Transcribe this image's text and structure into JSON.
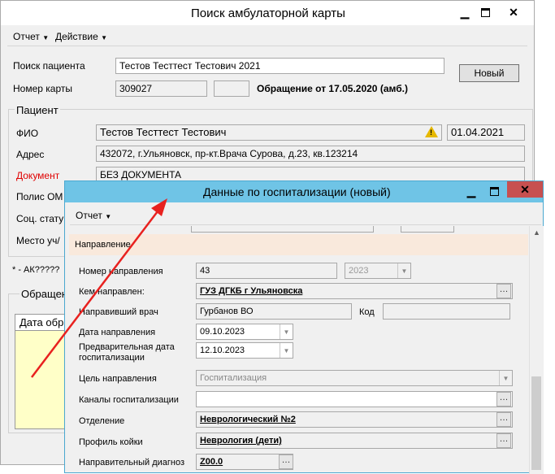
{
  "main": {
    "title": "Поиск амбулаторной карты",
    "menu": [
      "Отчет",
      "Действие"
    ],
    "search_label": "Поиск пациента",
    "search_value": "Тестов Тесттест Тестович 2021",
    "card_label": "Номер карты",
    "card_value": "309027",
    "appeal_text": "Обращение от 17.05.2020 (амб.)",
    "new_button": "Новый",
    "patient_group": "Пациент",
    "fio_label": "ФИО",
    "fio_value": "Тестов Тесттест Тестович",
    "birth_date": "01.04.2021",
    "address_label": "Адрес",
    "address_value": "432072, г.Ульяновск, пр-кт.Врача Сурова, д.23, кв.123214",
    "document_label": "Документ",
    "document_value": "БЕЗ ДОКУМЕНТА",
    "policy_label": "Полис ОМ",
    "social_label": "Соц. стату",
    "place_label": "Место уч/",
    "note_text": "* - АК?????",
    "appeals_group": "Обращен",
    "table_header": "Дата обр"
  },
  "dialog": {
    "title": "Данные по госпитализации (новый)",
    "menu": [
      "Отчет"
    ],
    "section_title": "Направление",
    "fields": {
      "referral_number_label": "Номер направления",
      "referral_number": "43",
      "referral_year": "2023",
      "sent_by_label": "Кем направлен:",
      "sent_by": "ГУЗ ДГКБ г Ульяновска",
      "doctor_label": "Направивший врач",
      "doctor": "Гурбанов ВО",
      "code_label": "Код",
      "code": "",
      "referral_date_label": "Дата направления",
      "referral_date": "09.10.2023",
      "prelim_date_label": "Предварительная дата госпитализации",
      "prelim_date": "12.10.2023",
      "purpose_label": "Цель направления",
      "purpose": "Госпитализация",
      "channels_label": "Каналы госпитализации",
      "channels": "",
      "department_label": "Отделение",
      "department": "Неврологический №2",
      "bed_profile_label": "Профиль койки",
      "bed_profile": "Неврология (дети)",
      "diagnosis_label": "Направительный диагноз",
      "diagnosis": "Z00.0"
    }
  },
  "colors": {
    "dialog_titlebar": "#6fc4e6",
    "close_button": "#c75050",
    "section_bg": "#f9e9dc",
    "document_label": "#e00000",
    "arrow": "#e8211f"
  }
}
